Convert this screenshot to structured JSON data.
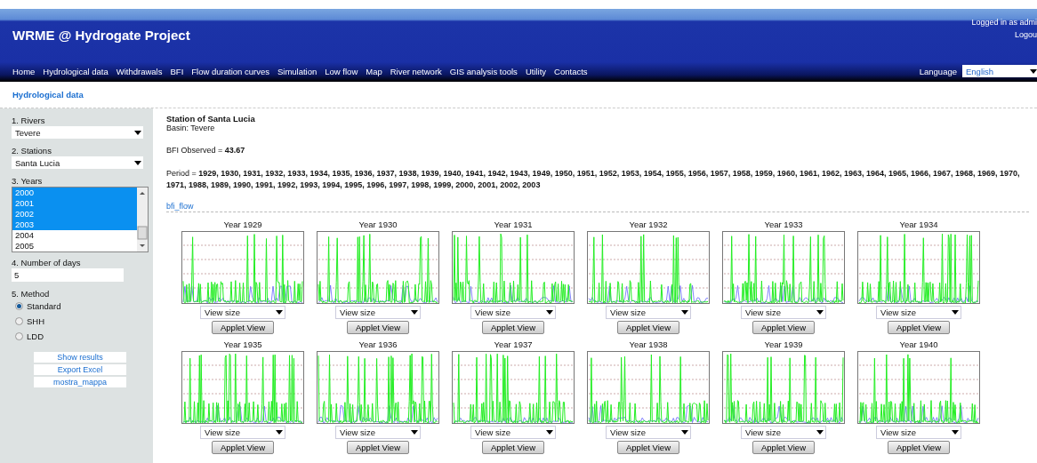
{
  "header": {
    "title": "WRME @ Hydrogate Project",
    "user": "Logged in as admi",
    "logout": "Logou",
    "language_label": "Language",
    "language": "English"
  },
  "nav": [
    "Home",
    "Hydrological data",
    "Withdrawals",
    "BFI",
    "Flow duration curves",
    "Simulation",
    "Low flow",
    "Map",
    "River network",
    "GIS analysis tools",
    "Utility",
    "Contacts"
  ],
  "breadcrumb": "Hydrological data",
  "sidebar": {
    "rivers_label": "1. Rivers",
    "river": "Tevere",
    "stations_label": "2. Stations",
    "station": "Santa Lucia",
    "years_label": "3. Years",
    "years": [
      {
        "label": "2000",
        "selected": true
      },
      {
        "label": "2001",
        "selected": true
      },
      {
        "label": "2002",
        "selected": true
      },
      {
        "label": "2003",
        "selected": true
      },
      {
        "label": "2004",
        "selected": false
      },
      {
        "label": "2005",
        "selected": false
      }
    ],
    "days_label": "4. Number of days",
    "days": "5",
    "method_label": "5. Method",
    "methods": [
      {
        "label": "Standard",
        "selected": true
      },
      {
        "label": "SHH",
        "selected": false
      },
      {
        "label": "LDD",
        "selected": false
      }
    ],
    "buttons": [
      "Show results",
      "Export Excel",
      "mostra_mappa"
    ]
  },
  "station": {
    "title": "Station of Santa Lucia",
    "basin": "Basin: Tevere",
    "bfi": "BFI Observed = **43.67**",
    "period": "Period = **1929, 1930, 1931, 1932, 1933, 1934, 1935, 1936, 1937, 1938, 1939, 1940, 1941, 1942, 1943, 1949, 1950, 1951, 1952, 1953, 1954, 1955, 1956, 1957, 1958, 1959, 1960, 1961, 1962, 1963, 1964, 1965, 1966, 1967, 1968, 1969, 1970, 1971, 1988, 1989, 1990, 1991, 1992, 1993, 1994, 1995, 1996, 1997, 1998, 1999, 2000, 2001, 2002, 2003**",
    "link": "bfi_flow"
  },
  "charts": [
    {
      "title": "Year 1929",
      "size": "View size",
      "button": "Applet View"
    },
    {
      "title": "Year 1930",
      "size": "View size",
      "button": "Applet View"
    },
    {
      "title": "Year 1931",
      "size": "View size",
      "button": "Applet View"
    },
    {
      "title": "Year 1932",
      "size": "View size",
      "button": "Applet View"
    },
    {
      "title": "Year 1933",
      "size": "View size",
      "button": "Applet View"
    },
    {
      "title": "Year 1934",
      "size": "View size",
      "button": "Applet View"
    },
    {
      "title": "Year 1935",
      "size": "View size",
      "button": "Applet View"
    },
    {
      "title": "Year 1936",
      "size": "View size",
      "button": "Applet View"
    },
    {
      "title": "Year 1937",
      "size": "View size",
      "button": "Applet View"
    },
    {
      "title": "Year 1938",
      "size": "View size",
      "button": "Applet View"
    },
    {
      "title": "Year 1939",
      "size": "View size",
      "button": "Applet View"
    },
    {
      "title": "Year 1940",
      "size": "View size",
      "button": "Applet View"
    }
  ]
}
